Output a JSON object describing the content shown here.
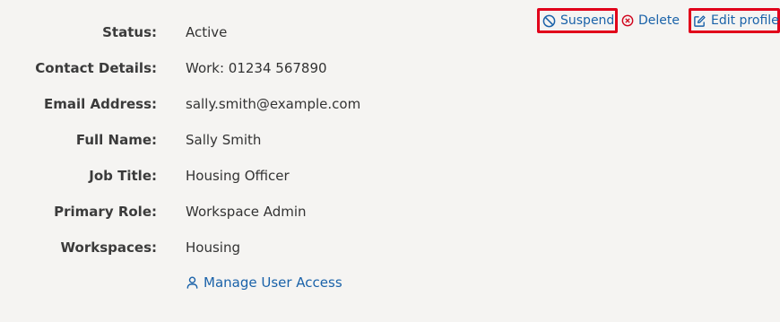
{
  "actions": {
    "suspend_label": "Suspend",
    "delete_label": "Delete",
    "edit_label": "Edit profile"
  },
  "details": {
    "status": {
      "label": "Status:",
      "value": "Active"
    },
    "contact": {
      "label": "Contact Details:",
      "value": "Work: 01234 567890"
    },
    "email": {
      "label": "Email Address:",
      "value": "sally.smith@example.com"
    },
    "full_name": {
      "label": "Full Name:",
      "value": "Sally Smith"
    },
    "job_title": {
      "label": "Job Title:",
      "value": "Housing Officer"
    },
    "primary_role": {
      "label": "Primary Role:",
      "value": "Workspace Admin"
    },
    "workspaces": {
      "label": "Workspaces:",
      "value": "Housing"
    }
  },
  "manage_access_label": "Manage User Access",
  "icons": {
    "suspend": "ban-icon",
    "delete": "close-circle-icon",
    "edit": "edit-icon",
    "manage": "user-icon"
  },
  "colors": {
    "link": "#1a62a9",
    "delete_icon": "#d0021b",
    "highlight": "#e1001a",
    "background": "#f5f4f2"
  }
}
